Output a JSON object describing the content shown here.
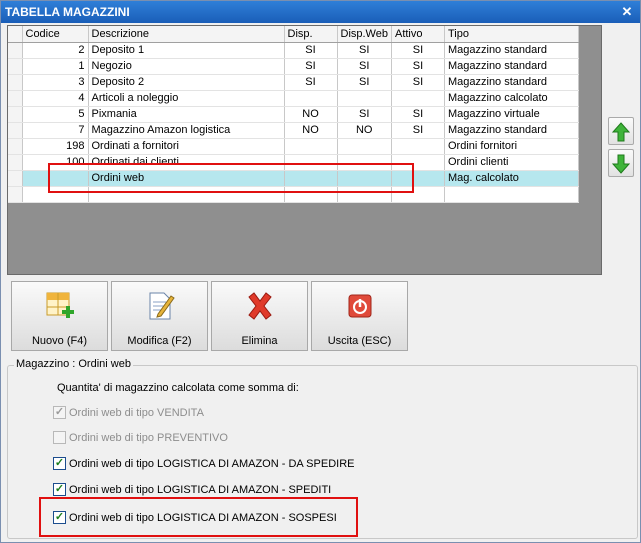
{
  "window": {
    "title": "TABELLA MAGAZZINI",
    "close_glyph": "✕"
  },
  "grid": {
    "columns": {
      "codice": "Codice",
      "descrizione": "Descrizione",
      "disp": "Disp.",
      "disp_web": "Disp.Web",
      "attivo": "Attivo",
      "tipo": "Tipo"
    },
    "rows": [
      {
        "codice": "2",
        "descrizione": "Deposito 1",
        "disp": "SI",
        "disp_web": "SI",
        "attivo": "SI",
        "tipo": "Magazzino standard"
      },
      {
        "codice": "1",
        "descrizione": "Negozio",
        "disp": "SI",
        "disp_web": "SI",
        "attivo": "SI",
        "tipo": "Magazzino standard"
      },
      {
        "codice": "3",
        "descrizione": "Deposito 2",
        "disp": "SI",
        "disp_web": "SI",
        "attivo": "SI",
        "tipo": "Magazzino standard"
      },
      {
        "codice": "4",
        "descrizione": "Articoli a noleggio",
        "disp": "",
        "disp_web": "",
        "attivo": "",
        "tipo": "Magazzino calcolato"
      },
      {
        "codice": "5",
        "descrizione": "Pixmania",
        "disp": "NO",
        "disp_web": "SI",
        "attivo": "SI",
        "tipo": "Magazzino virtuale"
      },
      {
        "codice": "7",
        "descrizione": "Magazzino Amazon logistica",
        "disp": "NO",
        "disp_web": "NO",
        "attivo": "SI",
        "tipo": "Magazzino standard"
      },
      {
        "codice": "198",
        "descrizione": "Ordinati a fornitori",
        "disp": "",
        "disp_web": "",
        "attivo": "",
        "tipo": "Ordini fornitori"
      },
      {
        "codice": "100",
        "descrizione": "Ordinati dai clienti",
        "disp": "",
        "disp_web": "",
        "attivo": "",
        "tipo": "Ordini clienti"
      },
      {
        "codice": "",
        "descrizione": "Ordini web",
        "disp": "",
        "disp_web": "",
        "attivo": "",
        "tipo": "Mag. calcolato"
      }
    ],
    "selected_row_index": 8
  },
  "toolbar": {
    "nuovo": "Nuovo (F4)",
    "modifica": "Modifica (F2)",
    "elimina": "Elimina",
    "uscita": "Uscita (ESC)"
  },
  "nav_icons": {
    "up": "green-up-arrow-icon",
    "down": "green-down-arrow-icon"
  },
  "group": {
    "title": "Magazzino : Ordini web",
    "sum_label": "Quantita' di magazzino calcolata come somma di:",
    "options": [
      {
        "label": "Ordini web di tipo VENDITA",
        "checked": true,
        "enabled": false
      },
      {
        "label": "Ordini web di tipo PREVENTIVO",
        "checked": false,
        "enabled": false
      },
      {
        "label": "Ordini web di tipo LOGISTICA DI AMAZON - DA SPEDIRE",
        "checked": true,
        "enabled": true
      },
      {
        "label": "Ordini web di tipo LOGISTICA DI AMAZON - SPEDITI",
        "checked": true,
        "enabled": true
      },
      {
        "label": "Ordini web di tipo LOGISTICA DI AMAZON - SOSPESI",
        "checked": true,
        "enabled": true
      }
    ]
  },
  "colors": {
    "title_bar": "#1a5eb8",
    "selected_row": "#b6e7ee",
    "highlight_box": "#e01010",
    "check": "#1d7e1d"
  }
}
